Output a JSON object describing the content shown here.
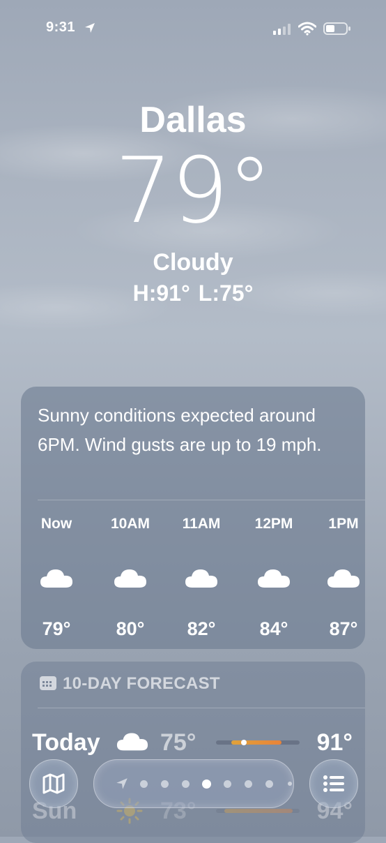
{
  "status_bar": {
    "time": "9:31"
  },
  "hero": {
    "city": "Dallas",
    "temperature": "79°",
    "condition": "Cloudy",
    "high": "H:91°",
    "low": "L:75°"
  },
  "hourly": {
    "summary": "Sunny conditions expected around 6PM. Wind gusts are up to 19 mph.",
    "items": [
      {
        "label": "Now",
        "icon": "cloud-icon",
        "temp": "79°"
      },
      {
        "label": "10AM",
        "icon": "cloud-icon",
        "temp": "80°"
      },
      {
        "label": "11AM",
        "icon": "cloud-icon",
        "temp": "82°"
      },
      {
        "label": "12PM",
        "icon": "cloud-icon",
        "temp": "84°"
      },
      {
        "label": "1PM",
        "icon": "cloud-icon",
        "temp": "87°"
      }
    ]
  },
  "forecast": {
    "header": "10-DAY FORECAST",
    "days": [
      {
        "day": "Today",
        "icon": "cloud-icon",
        "low": "75°",
        "high": "91°",
        "range_start": 0.18,
        "range_end": 0.78,
        "current": 0.33
      },
      {
        "day": "Sun",
        "icon": "sun-icon",
        "low": "73°",
        "high": "94°",
        "range_start": 0.1,
        "range_end": 0.92
      }
    ]
  },
  "toolbar": {
    "page_count": 8,
    "active_page": 3
  },
  "colors": {
    "range_bar_start": "#e0a23a",
    "range_bar_end": "#e8833a",
    "card_bg": "#6e7c91"
  }
}
